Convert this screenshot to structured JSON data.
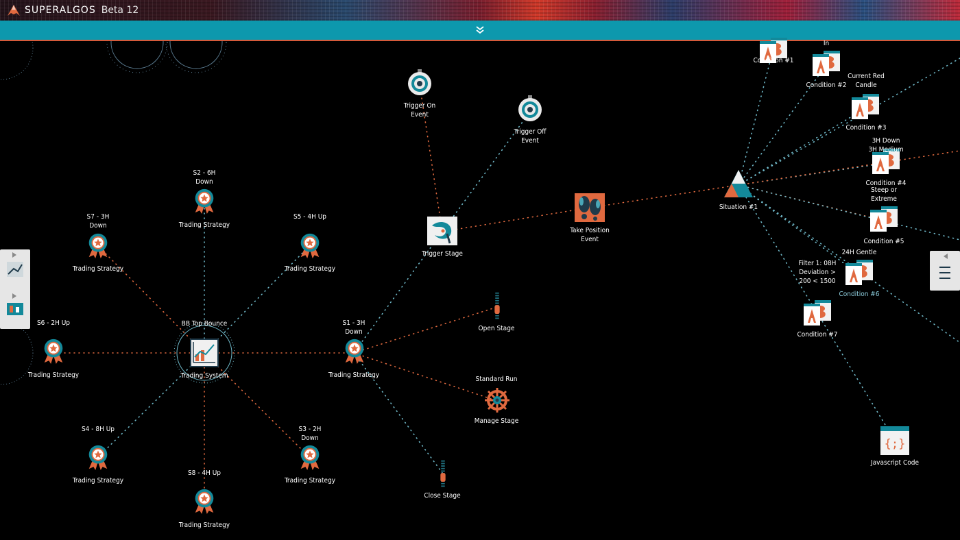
{
  "app": {
    "name": "SUPERALGOS",
    "version": "Beta 12"
  },
  "colors": {
    "accent": "#0d98ad",
    "orange": "#e0693f",
    "dark": "#1f3a4a",
    "line_orange": "#e0693f",
    "line_blue": "#6fb8c8"
  },
  "toolbar": {
    "collapse_icon": "chevrons-down-icon"
  },
  "nodes": {
    "trading_system": {
      "name": "BB Top Bounce",
      "type": "Trading System",
      "icon": "trading-system-icon"
    },
    "s1": {
      "name": "S1 - 3H Down",
      "type": "Trading Strategy",
      "icon": "ribbon-icon"
    },
    "s2": {
      "name": "S2 - 6H Down",
      "type": "Trading Strategy",
      "icon": "ribbon-icon"
    },
    "s3": {
      "name": "S3 - 2H Down",
      "type": "Trading Strategy",
      "icon": "ribbon-icon"
    },
    "s4": {
      "name": "S4 - 8H Up",
      "type": "Trading Strategy",
      "icon": "ribbon-icon"
    },
    "s5": {
      "name": "S5 - 4H Up",
      "type": "Trading Strategy",
      "icon": "ribbon-icon"
    },
    "s6": {
      "name": "S6 - 2H Up",
      "type": "Trading Strategy",
      "icon": "ribbon-icon"
    },
    "s7": {
      "name": "S7 - 3H Down",
      "type": "Trading Strategy",
      "icon": "ribbon-icon"
    },
    "s8": {
      "name": "S8 - 4H Up",
      "type": "Trading Strategy",
      "icon": "ribbon-icon"
    },
    "trigger_stage": {
      "type": "Trigger Stage",
      "icon": "trigger-stage-icon"
    },
    "trigger_on": {
      "type": "Trigger On Event",
      "icon": "stopwatch-icon"
    },
    "trigger_off": {
      "type": "Trigger Off Event",
      "icon": "stopwatch-icon"
    },
    "open_stage": {
      "type": "Open Stage",
      "icon": "zipper-icon"
    },
    "manage_stage": {
      "name": "Standard Run",
      "type": "Manage Stage",
      "icon": "ship-wheel-icon"
    },
    "close_stage": {
      "type": "Close Stage",
      "icon": "zipper-icon"
    },
    "take_position": {
      "type": "Take Position Event",
      "icon": "footprints-icon"
    },
    "situation": {
      "type": "Situation #1",
      "icon": "triangle-icon"
    },
    "c1": {
      "type": "Condition #1",
      "icon": "condition-icon"
    },
    "c2": {
      "name": "In",
      "type": "Condition #2",
      "icon": "condition-icon"
    },
    "c3": {
      "name": "Current Red Candle",
      "type": "Condition #3",
      "icon": "condition-icon"
    },
    "c4": {
      "name": "3H Down 3H Medium",
      "type": "Condition #4",
      "icon": "condition-icon"
    },
    "c5": {
      "name": "Steep or Extreme",
      "type": "Condition #5",
      "icon": "condition-icon"
    },
    "c6": {
      "name": "24H Gentle",
      "type": "Condition #6",
      "icon": "condition-icon"
    },
    "c7": {
      "name": "Filter 1: 08H Deviation > 200 < 1500",
      "type": "Condition #7",
      "icon": "condition-icon"
    },
    "js": {
      "type": "Javascript Code",
      "icon": "javascript-code-icon"
    }
  },
  "left_panel": {
    "icons": [
      "charting-space-icon",
      "data-storage-icon"
    ]
  },
  "right_panel": {
    "icons": [
      "arrow-left-icon",
      "settings-icon"
    ]
  }
}
